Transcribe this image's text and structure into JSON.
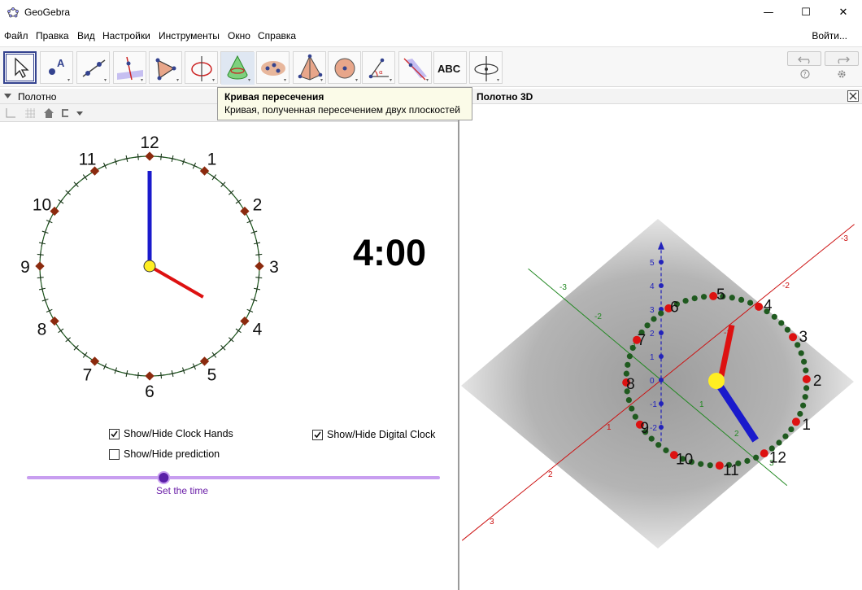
{
  "window": {
    "title": "GeoGebra"
  },
  "menu": [
    "Файл",
    "Правка",
    "Вид",
    "Настройки",
    "Инструменты",
    "Окно",
    "Справка"
  ],
  "login_label": "Войти...",
  "toolbar": {
    "tools": [
      "move-tool",
      "point-tool",
      "line-tool",
      "perpendicular-line-tool",
      "polygon-tool",
      "circle-tool",
      "intersection-curve-tool",
      "sphere-tool",
      "pyramid-tool",
      "circle-with-point-tool",
      "angle-tool",
      "reflect-tool",
      "text-tool",
      "rotate-view-tool"
    ],
    "text_tool_label": "ABC"
  },
  "tooltip": {
    "title": "Кривая пересечения",
    "description": "Кривая, полученная пересечением двух плоскостей"
  },
  "panels": {
    "left_title": "Полотно",
    "right_title": "Полотно 3D"
  },
  "clock": {
    "hours": 4,
    "minutes": 0,
    "numbers": [
      "12",
      "1",
      "2",
      "3",
      "4",
      "5",
      "6",
      "7",
      "8",
      "9",
      "10",
      "11"
    ],
    "digital": "4:00"
  },
  "checkboxes": [
    {
      "label": "Show/Hide Clock Hands",
      "checked": true
    },
    {
      "label": "Show/Hide prediction",
      "checked": false
    },
    {
      "label": "Show/Hide Digital Clock",
      "checked": true
    }
  ],
  "slider": {
    "caption": "Set the time",
    "value_fraction": 0.33
  },
  "view3d": {
    "z_ticks": [
      "-2",
      "-1",
      "0",
      "1",
      "2",
      "3",
      "4",
      "5"
    ],
    "y_ticks": [
      "-3",
      "-2",
      "-1",
      "1",
      "2",
      "3"
    ],
    "x_ticks": [
      "-3",
      "-2",
      "-1",
      "1",
      "2",
      "3"
    ],
    "numbers": [
      "12",
      "1",
      "2",
      "3",
      "4",
      "5",
      "6",
      "7",
      "8",
      "9",
      "10",
      "11"
    ]
  },
  "colors": {
    "minute_hand": "#1a1acc",
    "hour_hand": "#dd1111",
    "center": "#ffee22",
    "tick_diamond": "#8b2a0e",
    "circle": "#1f5a1f",
    "slider": "#c89ef0",
    "slider_knob": "#5a1fa8",
    "selected_tool": "#34438f"
  }
}
